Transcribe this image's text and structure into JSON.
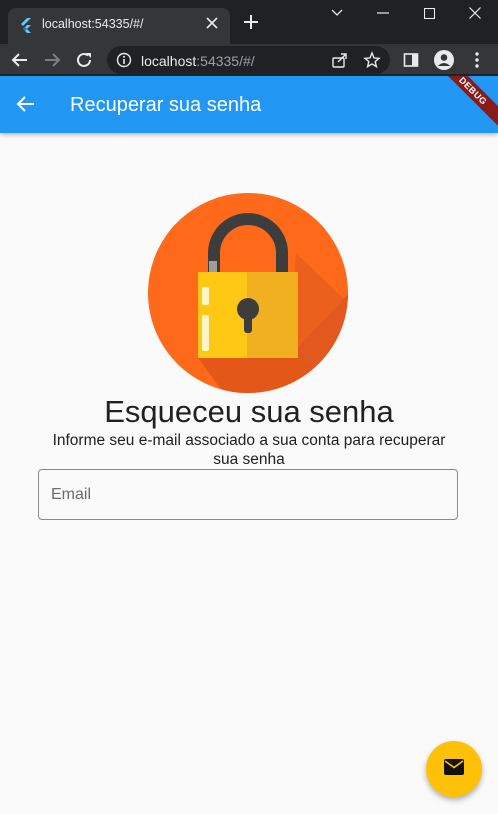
{
  "browser": {
    "tab": {
      "title": "localhost:54335/#/",
      "favicon": "flutter-icon",
      "close_icon": "close-icon"
    },
    "new_tab_icon": "plus-icon",
    "window_controls": [
      "chevron-down-icon",
      "minimize-icon",
      "maximize-icon",
      "close-icon"
    ],
    "address_bar": {
      "host": "localhost",
      "rest": ":54335/#/",
      "info_icon": "info-icon",
      "share_icon": "share-icon",
      "bookmark_icon": "star-icon"
    },
    "nav_icons": [
      "back-arrow-icon",
      "forward-arrow-icon",
      "reload-icon"
    ],
    "right_icons": [
      "side-panel-icon",
      "profile-icon",
      "menu-dots-icon"
    ]
  },
  "app": {
    "appbar": {
      "title": "Recuperar sua senha",
      "back_icon": "arrow-back-icon",
      "debug_banner": "DEBUG",
      "color": "#2196f3"
    },
    "illustration": "padlock-icon",
    "heading": "Esqueceu sua senha",
    "subtext": "Informe seu e-mail associado a sua conta para recuperar sua senha",
    "email_field": {
      "placeholder": "Email",
      "value": ""
    },
    "fab": {
      "icon": "mail-icon",
      "color": "#ffc107"
    }
  }
}
